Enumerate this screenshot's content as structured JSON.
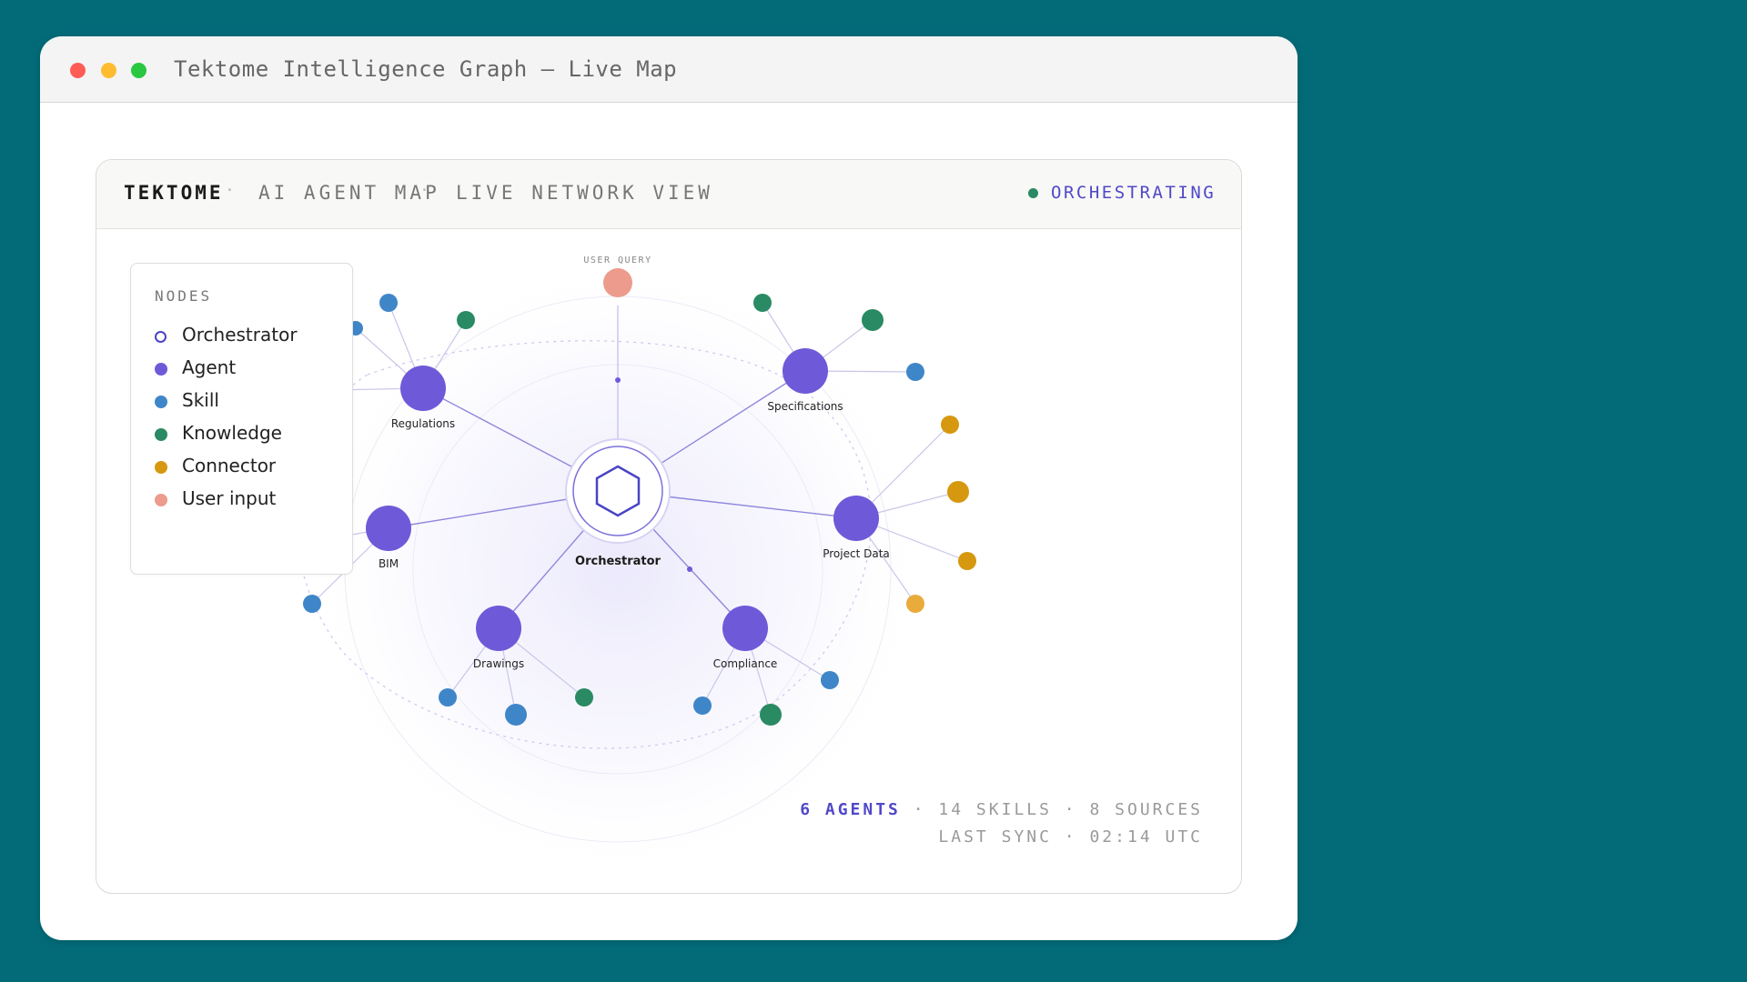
{
  "window": {
    "title": "Tektome Intelligence Graph — Live Map"
  },
  "header": {
    "brand": "TEKTOME",
    "separator": "·",
    "items": [
      "AI AGENT MAP",
      "LIVE NETWORK VIEW"
    ],
    "status": "ORCHESTRATING",
    "status_color": "#2a8a63"
  },
  "legend": {
    "title": "NODES",
    "items": [
      {
        "label": "Orchestrator",
        "color": "#4a44c6",
        "style": "ring"
      },
      {
        "label": "Agent",
        "color": "#6e5ad8",
        "style": "fill"
      },
      {
        "label": "Skill",
        "color": "#3f86c9",
        "style": "fill"
      },
      {
        "label": "Knowledge",
        "color": "#2a8a63",
        "style": "fill"
      },
      {
        "label": "Connector",
        "color": "#d6980f",
        "style": "fill"
      },
      {
        "label": "User input",
        "color": "#ec9b8c",
        "style": "fill"
      }
    ]
  },
  "graph": {
    "orchestrator_label": "Orchestrator",
    "user_query_label": "USER QUERY",
    "agents": [
      "Regulations",
      "Specifications",
      "Project Data",
      "Compliance",
      "Drawings",
      "BIM"
    ]
  },
  "stats": {
    "agents": "6 AGENTS",
    "rest": "· 14 SKILLS · 8 SOURCES",
    "last_sync": "LAST SYNC · 02:14 UTC"
  }
}
